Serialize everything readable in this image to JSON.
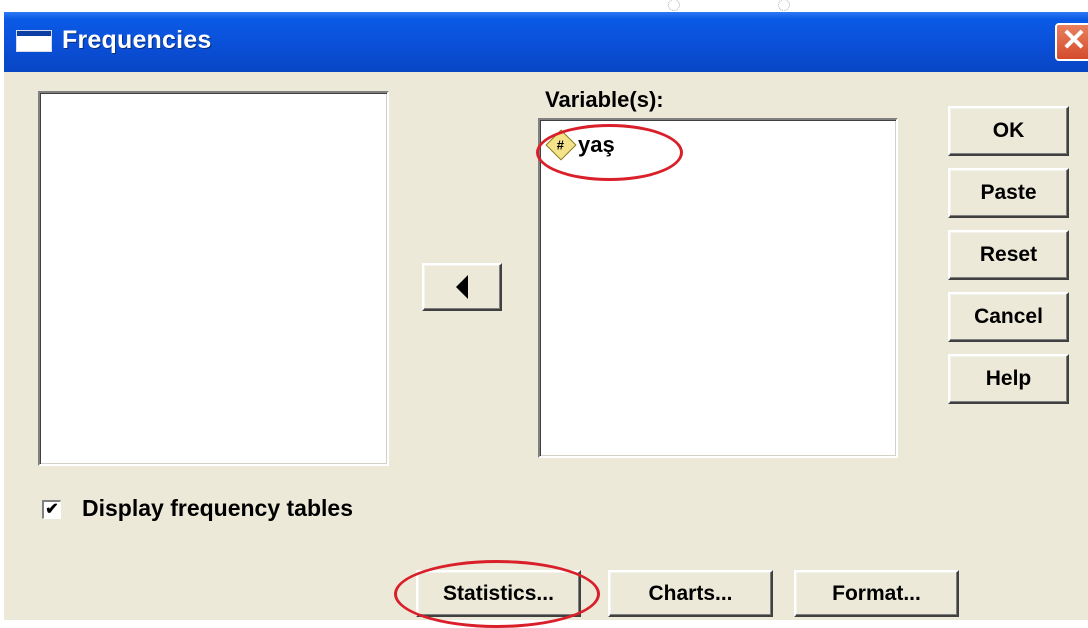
{
  "window": {
    "title": "Frequencies",
    "close_symbol": "✕"
  },
  "variables_panel": {
    "label": "Variable(s):",
    "items": [
      {
        "icon": "numeric-variable-icon",
        "icon_glyph": "#",
        "name": "yaş"
      }
    ]
  },
  "move_button": {
    "icon": "left-arrow-icon"
  },
  "side_buttons": {
    "ok": "OK",
    "paste": "Paste",
    "reset": "Reset",
    "cancel": "Cancel",
    "help": "Help"
  },
  "options": {
    "display_frequency_tables": {
      "label": "Display frequency tables",
      "checked": true,
      "check_symbol": "✔"
    }
  },
  "bottom_buttons": {
    "statistics": "Statistics...",
    "charts": "Charts...",
    "format": "Format..."
  },
  "colors": {
    "titlebar": "#0a4fd8",
    "dialog": "#ece9d8",
    "annotation": "#d9202a"
  }
}
